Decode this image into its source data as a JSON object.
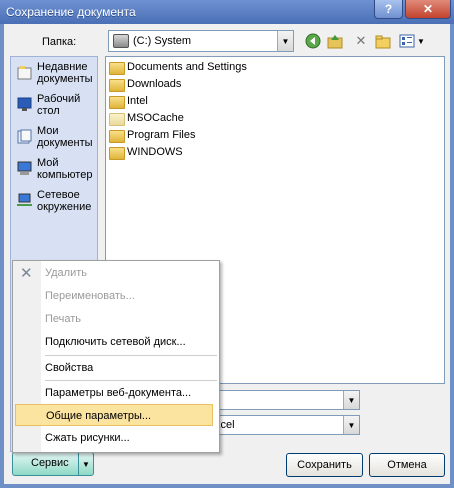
{
  "window": {
    "title": "Сохранение документа",
    "help_glyph": "?",
    "close_glyph": "✕"
  },
  "toolbar": {
    "folder_label": "Папка:",
    "folder_value": "(C:) System",
    "icons": [
      "back-icon",
      "up-folder-icon",
      "delete-icon",
      "new-folder-icon",
      "views-icon"
    ]
  },
  "places": [
    {
      "label_line1": "Недавние",
      "label_line2": "документы",
      "icon": "recent-documents-icon"
    },
    {
      "label_line1": "Рабочий",
      "label_line2": "стол",
      "icon": "desktop-icon"
    },
    {
      "label_line1": "Мои",
      "label_line2": "документы",
      "icon": "my-documents-icon"
    },
    {
      "label_line1": "Мой",
      "label_line2": "компьютер",
      "icon": "my-computer-icon"
    },
    {
      "label_line1": "Сетевое",
      "label_line2": "окружение",
      "icon": "network-icon"
    }
  ],
  "files": [
    "Documents and Settings",
    "Downloads",
    "Intel",
    "MSOCache",
    "Program Files",
    "WINDOWS"
  ],
  "fields": {
    "type_value_fragment": "xcel"
  },
  "context_menu": {
    "items": [
      {
        "label": "Удалить",
        "disabled": true
      },
      {
        "label": "Переименовать...",
        "disabled": true
      },
      {
        "label": "Печать",
        "disabled": true
      },
      {
        "label": "Подключить сетевой диск...",
        "disabled": false
      },
      {
        "label": "Свойства",
        "disabled": false
      },
      {
        "label": "Параметры веб-документа...",
        "disabled": false
      },
      {
        "label": "Общие параметры...",
        "disabled": false,
        "highlighted": true
      },
      {
        "label": "Сжать рисунки...",
        "disabled": false
      }
    ]
  },
  "buttons": {
    "service": "Сервис",
    "save": "Сохранить",
    "cancel": "Отмена"
  }
}
